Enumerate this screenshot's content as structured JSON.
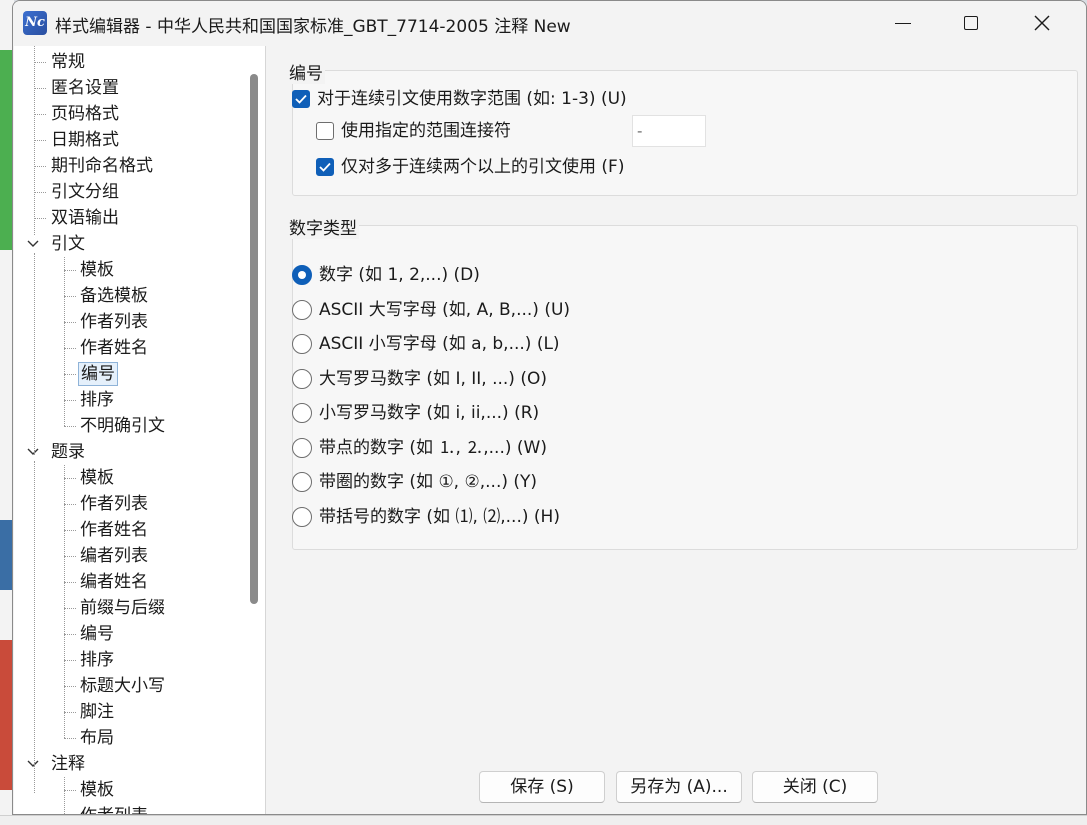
{
  "window": {
    "title": "样式编辑器 - 中华人民共和国国家标准_GBT_7714-2005 注释 New",
    "app_icon_text": "Nc"
  },
  "tree": {
    "items": [
      {
        "label": "常规",
        "level": 0
      },
      {
        "label": "匿名设置",
        "level": 0
      },
      {
        "label": "页码格式",
        "level": 0
      },
      {
        "label": "日期格式",
        "level": 0
      },
      {
        "label": "期刊命名格式",
        "level": 0
      },
      {
        "label": "引文分组",
        "level": 0
      },
      {
        "label": "双语输出",
        "level": 0
      },
      {
        "label": "引文",
        "level": 0,
        "expanded": true
      },
      {
        "label": "模板",
        "level": 1
      },
      {
        "label": "备选模板",
        "level": 1
      },
      {
        "label": "作者列表",
        "level": 1
      },
      {
        "label": "作者姓名",
        "level": 1
      },
      {
        "label": "编号",
        "level": 1,
        "selected": true
      },
      {
        "label": "排序",
        "level": 1
      },
      {
        "label": "不明确引文",
        "level": 1
      },
      {
        "label": "题录",
        "level": 0,
        "expanded": true
      },
      {
        "label": "模板",
        "level": 1
      },
      {
        "label": "作者列表",
        "level": 1
      },
      {
        "label": "作者姓名",
        "level": 1
      },
      {
        "label": "编者列表",
        "level": 1
      },
      {
        "label": "编者姓名",
        "level": 1
      },
      {
        "label": "前缀与后缀",
        "level": 1
      },
      {
        "label": "编号",
        "level": 1
      },
      {
        "label": "排序",
        "level": 1
      },
      {
        "label": "标题大小写",
        "level": 1
      },
      {
        "label": "脚注",
        "level": 1
      },
      {
        "label": "布局",
        "level": 1
      },
      {
        "label": "注释",
        "level": 0,
        "expanded": true
      },
      {
        "label": "模板",
        "level": 1
      },
      {
        "label": "作者列表",
        "level": 1
      }
    ]
  },
  "numbering": {
    "title": "编号",
    "use_range": {
      "label": "对于连续引文使用数字范围 (如: 1-3) (U)",
      "checked": true
    },
    "custom_connector": {
      "label": "使用指定的范围连接符",
      "checked": false,
      "value": "-"
    },
    "only_more_than_two": {
      "label": "仅对多于连续两个以上的引文使用 (F)",
      "checked": true
    }
  },
  "number_type": {
    "title": "数字类型",
    "options": [
      {
        "label": "数字 (如 1, 2,...) (D)",
        "checked": true
      },
      {
        "label": "ASCII 大写字母 (如, A, B,...) (U)",
        "checked": false
      },
      {
        "label": "ASCII 小写字母 (如 a, b,...) (L)",
        "checked": false
      },
      {
        "label": "大写罗马数字 (如 I, II, ...) (O)",
        "checked": false
      },
      {
        "label": "小写罗马数字 (如 i, ii,...) (R)",
        "checked": false
      },
      {
        "label": "带点的数字 (如 ⒈, ⒉,...) (W)",
        "checked": false
      },
      {
        "label": "带圈的数字 (如 ①, ②,...) (Y)",
        "checked": false
      },
      {
        "label": "带括号的数字 (如 ⑴, ⑵,...) (H)",
        "checked": false
      }
    ]
  },
  "buttons": {
    "save": "保存 (S)",
    "save_as": "另存为 (A)...",
    "close": "关闭 (C)"
  },
  "colors": {
    "accent": "#0f5fb8",
    "selection_bg": "#e5f0fb",
    "selection_border": "#8fb3d8"
  }
}
